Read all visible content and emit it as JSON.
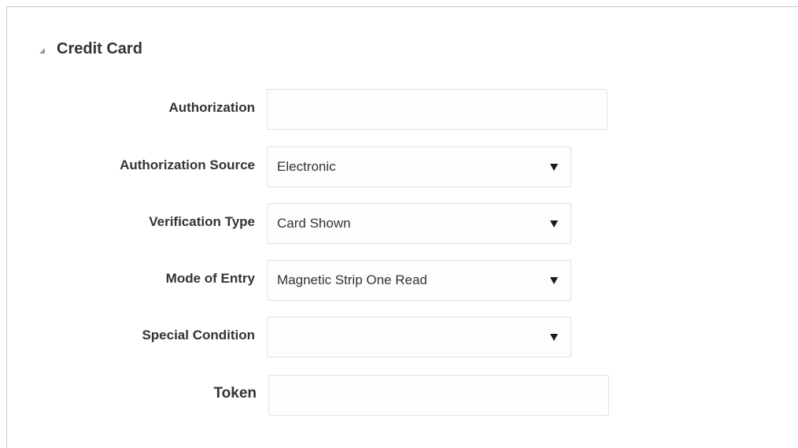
{
  "section": {
    "title": "Credit Card"
  },
  "fields": {
    "authorization": {
      "label": "Authorization",
      "value": ""
    },
    "authorization_source": {
      "label": "Authorization Source",
      "value": "Electronic"
    },
    "verification_type": {
      "label": "Verification Type",
      "value": "Card Shown"
    },
    "mode_of_entry": {
      "label": "Mode of Entry",
      "value": "Magnetic Strip One Read"
    },
    "special_condition": {
      "label": "Special Condition",
      "value": ""
    },
    "token": {
      "label": "Token",
      "value": ""
    }
  },
  "icons": {
    "disclosure": "collapse-triangle-icon",
    "dropdown": "chevron-down-icon"
  },
  "colors": {
    "text": "#333333",
    "border": "#dfe4e7",
    "field_background": "#fcfdfe",
    "panel_border": "#c9cbcd"
  }
}
